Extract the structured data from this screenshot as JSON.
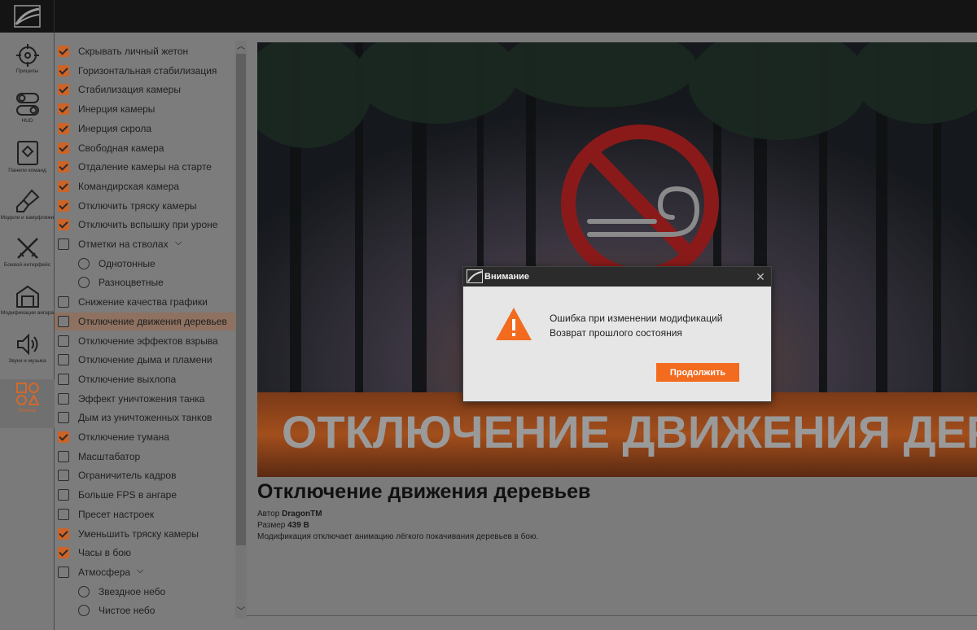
{
  "sidebar": {
    "items": [
      {
        "label": "Прицелы",
        "icon": "crosshair-icon"
      },
      {
        "label": "HUD",
        "icon": "toggle-icon"
      },
      {
        "label": "Панели команд",
        "icon": "shield-icon"
      },
      {
        "label": "Модели и камуфляжи",
        "icon": "brush-icon"
      },
      {
        "label": "Боевой интерфейс",
        "icon": "crossed-swords-icon"
      },
      {
        "label": "Модификации ангара",
        "icon": "hangar-icon"
      },
      {
        "label": "Звуки и музыка",
        "icon": "speaker-icon"
      },
      {
        "label": "Разное",
        "icon": "shapes-icon"
      }
    ],
    "active_index": 7
  },
  "mods": [
    {
      "label": "Скрывать личный жетон",
      "checked": true
    },
    {
      "label": "Горизонтальная стабилизация",
      "checked": true
    },
    {
      "label": "Стабилизация камеры",
      "checked": true
    },
    {
      "label": "Инерция камеры",
      "checked": true
    },
    {
      "label": "Инерция скрола",
      "checked": true
    },
    {
      "label": "Свободная камера",
      "checked": true
    },
    {
      "label": "Отдаление камеры на старте",
      "checked": true
    },
    {
      "label": "Командирская камера",
      "checked": true
    },
    {
      "label": "Отключить тряску камеры",
      "checked": true
    },
    {
      "label": "Отключить вспышку при уроне",
      "checked": true
    },
    {
      "label": "Отметки на стволах",
      "checked": false,
      "expandable": true
    },
    {
      "label": "Однотонные",
      "radio": true
    },
    {
      "label": "Разноцветные",
      "radio": true
    },
    {
      "label": "Снижение качества графики",
      "checked": false
    },
    {
      "label": "Отключение движения деревьев",
      "checked": false,
      "selected": true
    },
    {
      "label": "Отключение эффектов взрыва",
      "checked": false
    },
    {
      "label": "Отключение дыма и пламени",
      "checked": false
    },
    {
      "label": "Отключение выхлопа",
      "checked": false
    },
    {
      "label": "Эффект уничтожения танка",
      "checked": false
    },
    {
      "label": "Дым из уничтоженных танков",
      "checked": false
    },
    {
      "label": "Отключение тумана",
      "checked": true
    },
    {
      "label": "Масштабатор",
      "checked": false
    },
    {
      "label": "Ограничитель кадров",
      "checked": false
    },
    {
      "label": "Больше FPS в ангаре",
      "checked": false
    },
    {
      "label": "Пресет настроек",
      "checked": false
    },
    {
      "label": "Уменьшить тряску камеры",
      "checked": true
    },
    {
      "label": "Часы в бою",
      "checked": true
    },
    {
      "label": "Атмосфера",
      "checked": false,
      "expandable": true
    },
    {
      "label": "Звездное небо",
      "radio": true
    },
    {
      "label": "Чистое небо",
      "radio": true
    }
  ],
  "preview": {
    "banner_text": "ОТКЛЮЧЕНИЕ ДВИЖЕНИЯ ДЕРЕВЬЕВ",
    "title": "Отключение движения деревьев",
    "author_label": "Автор",
    "author": "DragonTM",
    "size_label": "Размер",
    "size": "439 В",
    "description": "Модификация отключает анимацию лёгкого покачивания деревьев в бою."
  },
  "dialog": {
    "title": "Внимание",
    "line1": "Ошибка при изменении модификаций",
    "line2": "Возврат прошлого состояния",
    "button": "Продолжить",
    "close_icon": "close-icon",
    "icon": "warning-icon"
  },
  "colors": {
    "accent": "#f26b1f",
    "checkbox": "#cc6428",
    "dim_overlay": "#7b7b7b",
    "titlebar": "#141414"
  }
}
